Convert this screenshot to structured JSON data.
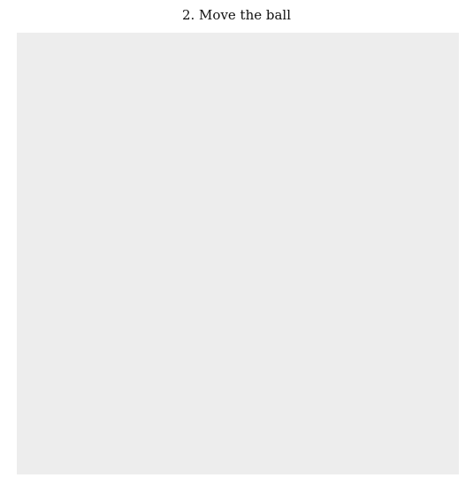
{
  "task": {
    "title": "2. Move the ball"
  },
  "colors": {
    "background": "#ffffff",
    "canvas": "#ededed",
    "text": "#111111"
  }
}
